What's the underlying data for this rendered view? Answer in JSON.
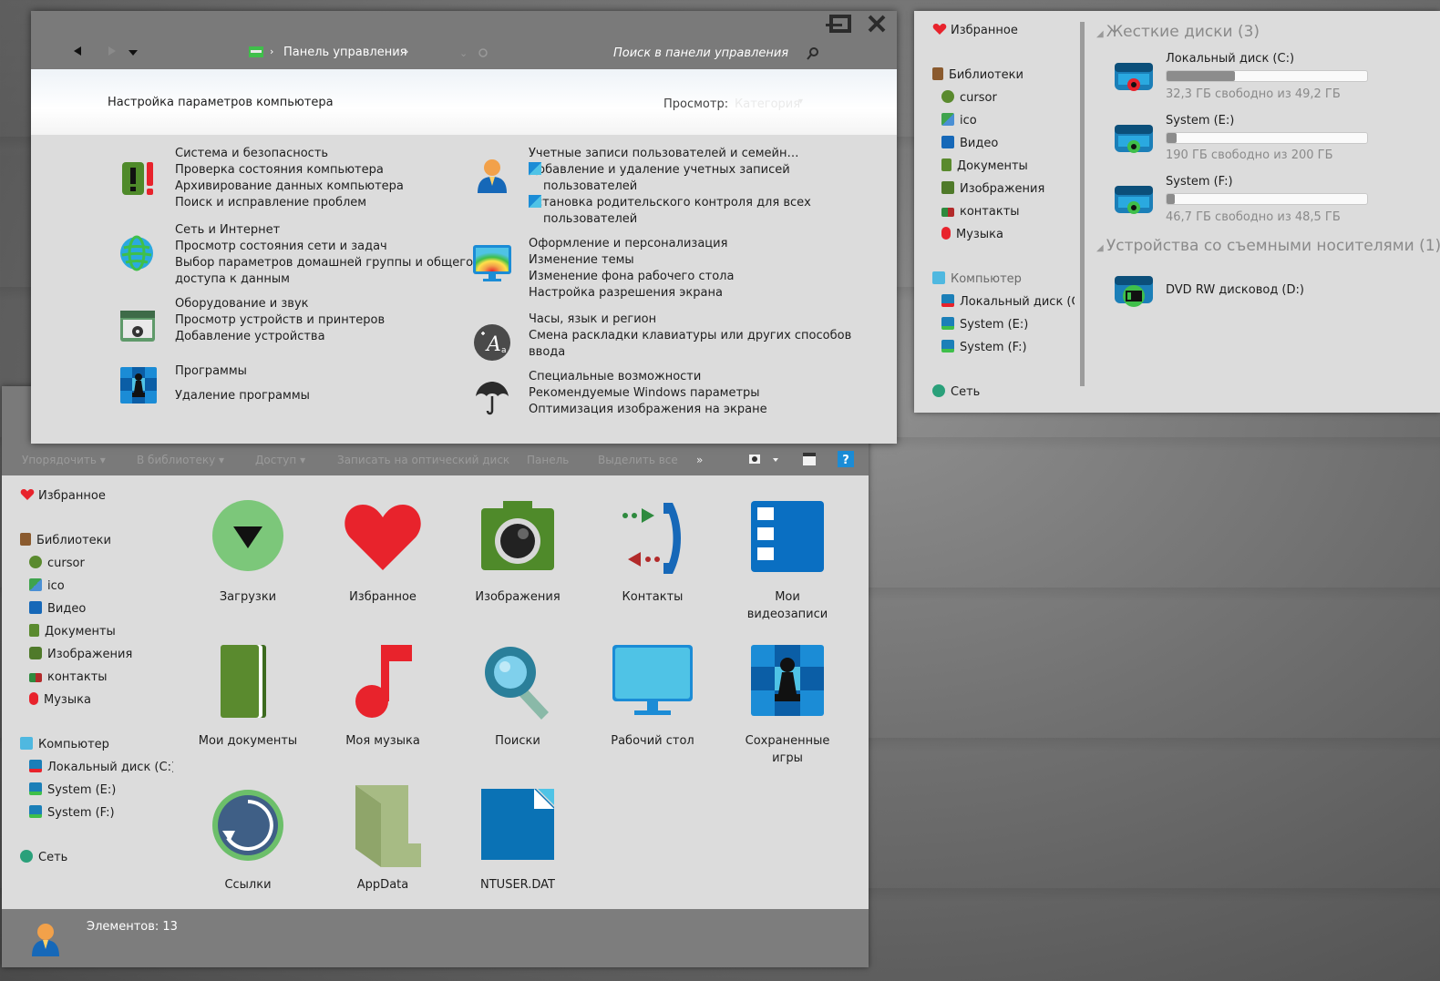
{
  "control_panel": {
    "breadcrumb_root": "Панель управления",
    "search_placeholder": "Поиск в панели управления",
    "heading": "Настройка параметров компьютера",
    "view_label": "Просмотр:",
    "view_value": "Категория",
    "categories_left": [
      {
        "title": "Система и безопасность",
        "links": [
          "Проверка состояния компьютера",
          "Архивирование данных компьютера",
          "Поиск и исправление проблем"
        ],
        "icon": "system-security-icon"
      },
      {
        "title": "Сеть и Интернет",
        "links": [
          "Просмотр состояния сети и задач",
          "Выбор параметров домашней группы и общего",
          "доступа к данным"
        ],
        "icon": "network-globe-icon"
      },
      {
        "title": "Оборудование и звук",
        "links": [
          "Просмотр устройств и принтеров",
          "Добавление устройства"
        ],
        "icon": "hardware-sound-icon"
      },
      {
        "title": "Программы",
        "links": [
          "Удаление программы"
        ],
        "icon": "programs-chess-icon"
      }
    ],
    "categories_right": [
      {
        "title": "Учетные записи пользователей и семейн…",
        "links": [
          "Добавление и удаление учетных записей",
          "пользователей",
          "Установка родительского контроля для всех",
          "пользователей"
        ],
        "icon": "user-accounts-icon"
      },
      {
        "title": "Оформление и персонализация",
        "links": [
          "Изменение темы",
          "Изменение фона рабочего стола",
          "Настройка разрешения экрана"
        ],
        "icon": "personalization-monitor-icon"
      },
      {
        "title": "Часы, язык и регион",
        "links": [
          "Смена раскладки клавиатуры или других способов",
          "ввода"
        ],
        "icon": "clock-language-icon"
      },
      {
        "title": "Специальные возможности",
        "links": [
          "Рекомендуемые Windows параметры",
          "Оптимизация изображения на экране"
        ],
        "icon": "accessibility-umbrella-icon"
      }
    ]
  },
  "computer": {
    "nav": {
      "favorites": "Избранное",
      "libraries": "Библиотеки",
      "library_items": [
        "cursor",
        "ico",
        "Видео",
        "Документы",
        "Изображения",
        "контакты",
        "Музыка"
      ],
      "computer": "Компьютер",
      "computer_items": [
        "Локальный диск (C:",
        "System (E:)",
        "System (F:)"
      ],
      "network": "Сеть"
    },
    "hard_drives_header": "Жесткие диски (3)",
    "drives": [
      {
        "name": "Локальный диск (C:)",
        "free": "32,3 ГБ свободно из 49,2 ГБ",
        "used_fraction": 0.34
      },
      {
        "name": "System (E:)",
        "free": "190 ГБ свободно из 200 ГБ",
        "used_fraction": 0.05
      },
      {
        "name": "System (F:)",
        "free": "46,7 ГБ свободно из 48,5 ГБ",
        "used_fraction": 0.04
      }
    ],
    "removable_header": "Устройства со съемными носителями (1)",
    "dvd": "DVD RW дисковод (D:)"
  },
  "explorer": {
    "toolbar": [
      "Упорядочить ▾",
      "В библиотеку ▾",
      "Доступ ▾",
      "Записать на оптический диск",
      "Панель",
      "Выделить все",
      "»"
    ],
    "nav": {
      "favorites": "Избранное",
      "libraries": "Библиотеки",
      "library_items": [
        "cursor",
        "ico",
        "Видео",
        "Документы",
        "Изображения",
        "контакты",
        "Музыка"
      ],
      "computer": "Компьютер",
      "computer_items": [
        "Локальный диск (C:)",
        "System (E:)",
        "System (F:)"
      ],
      "network": "Сеть"
    },
    "tiles": [
      [
        "Загрузки"
      ],
      [
        "Избранное"
      ],
      [
        "Изображения"
      ],
      [
        "Контакты"
      ],
      [
        "Мои",
        "видеозаписи"
      ],
      [
        "Мои документы"
      ],
      [
        "Моя музыка"
      ],
      [
        "Поиски"
      ],
      [
        "Рабочий стол"
      ],
      [
        "Сохраненные",
        "игры"
      ],
      [
        "Ссылки"
      ],
      [
        "AppData"
      ],
      [
        "NTUSER.DAT"
      ]
    ],
    "status": "Элементов: 13"
  }
}
